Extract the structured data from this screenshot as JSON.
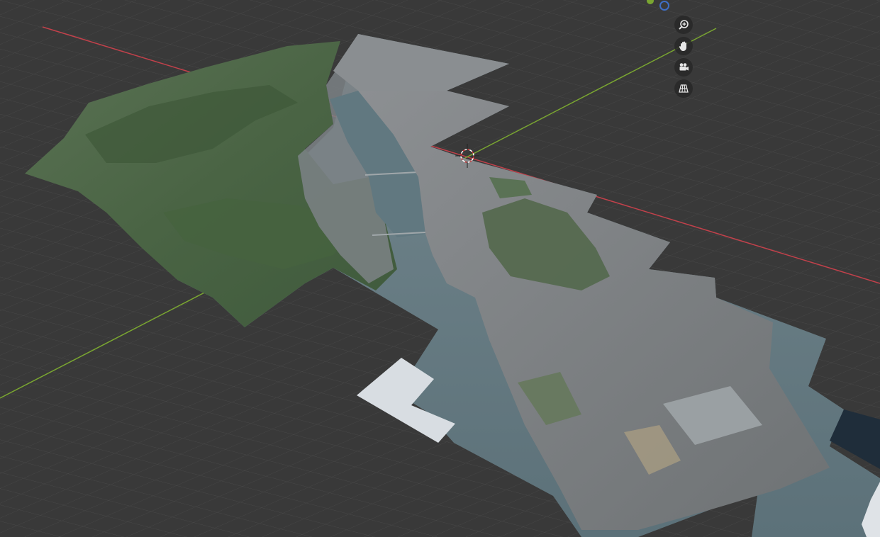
{
  "viewport": {
    "background": "#3a3a3a",
    "grid_color": "#4a4a4a",
    "x_axis_color": "#c2414b",
    "y_axis_color": "#7aa631"
  },
  "nav_tools": [
    {
      "name": "zoom",
      "icon": "magnify-plus-icon"
    },
    {
      "name": "pan",
      "icon": "hand-icon"
    },
    {
      "name": "camera-view",
      "icon": "camera-icon"
    },
    {
      "name": "ortho-toggle",
      "icon": "grid-perspective-icon"
    }
  ],
  "gizmo_axis": {
    "y_dot_color": "#7aa631",
    "z_dot_color": "#3f6fc6"
  },
  "scene_object": {
    "name": "terrain-mesh",
    "forest_color": "#4f6a46",
    "urban_color": "#7c7f82",
    "water_color": "#6a8088",
    "snow_patch_color": "#d8dde2"
  }
}
